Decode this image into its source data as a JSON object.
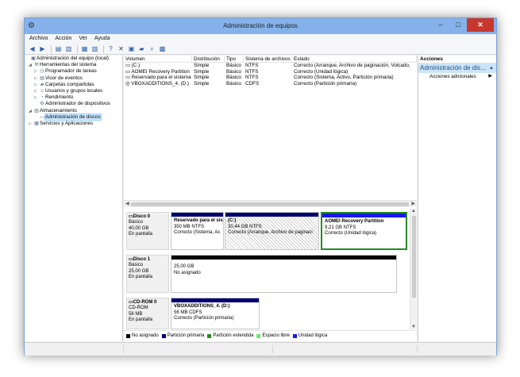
{
  "window": {
    "title": "Administración de equipos",
    "minimize": "–",
    "maximize": "□",
    "close": "✕"
  },
  "menu": [
    "Archivo",
    "Acción",
    "Ver",
    "Ayuda"
  ],
  "tree": [
    {
      "label": "Administración del equipo (local)",
      "level": 0,
      "arrow": "",
      "icon": "▣"
    },
    {
      "label": "Herramientas del sistema",
      "level": 1,
      "arrow": "◢",
      "icon": "⚒"
    },
    {
      "label": "Programador de tareas",
      "level": 2,
      "arrow": "▷",
      "icon": "◷"
    },
    {
      "label": "Visor de eventos",
      "level": 2,
      "arrow": "▷",
      "icon": "▤"
    },
    {
      "label": "Carpetas compartidas",
      "level": 2,
      "arrow": "▷",
      "icon": "▰"
    },
    {
      "label": "Usuarios y grupos locales",
      "level": 2,
      "arrow": "▷",
      "icon": "☺"
    },
    {
      "label": "Rendimiento",
      "level": 2,
      "arrow": "▷",
      "icon": "◔"
    },
    {
      "label": "Administrador de dispositivos",
      "level": 2,
      "arrow": "",
      "icon": "⚙"
    },
    {
      "label": "Almacenamiento",
      "level": 1,
      "arrow": "◢",
      "icon": "▥"
    },
    {
      "label": "Administración de discos",
      "level": 2,
      "arrow": "",
      "icon": "▭",
      "selected": true
    },
    {
      "label": "Servicios y Aplicaciones",
      "level": 1,
      "arrow": "▷",
      "icon": "▦"
    }
  ],
  "volume_table": {
    "headers": [
      "Volumen",
      "Distribución",
      "Tipo",
      "Sistema de archivos",
      "Estado"
    ],
    "rows": [
      [
        "(C:)",
        "Simple",
        "Básico",
        "NTFS",
        "Correcto (Arranque, Archivo de paginación, Volcado,"
      ],
      [
        "AOMEI Recovery Partition",
        "Simple",
        "Básico",
        "NTFS",
        "Correcto (Unidad lógica)"
      ],
      [
        "Reservado para el sistema",
        "Simple",
        "Básico",
        "NTFS",
        "Correcto (Sistema, Activo, Partición primaria)"
      ],
      [
        "VBOXADDITIONS_4. (D:)",
        "Simple",
        "Básico",
        "CDFS",
        "Correcto (Partición primaria)"
      ]
    ]
  },
  "disks": [
    {
      "name": "Disco 0",
      "type": "Básico",
      "size": "40,00 GB",
      "state": "En pantalla",
      "partitions": [
        {
          "name": "Reservado para el sis",
          "size": "350 MB NTFS",
          "status": "Correcto (Sistema, Ac",
          "bar_color": "#00006f",
          "hatched": false,
          "selected": false
        },
        {
          "name": "(C:)",
          "size": "30,44 GB NTFS",
          "status": "Correcto (Arranque, Archivo de paginaci",
          "bar_color": "#00006f",
          "hatched": true,
          "selected": false
        },
        {
          "name": "AOMEI Recovery Partition",
          "size": "9,21 GB NTFS",
          "status": "Correcto (Unidad lógica)",
          "bar_color": "#1818e8",
          "hatched": false,
          "selected": true
        }
      ]
    },
    {
      "name": "Disco 1",
      "type": "Básico",
      "size": "25,00 GB",
      "state": "En pantalla",
      "partitions": [
        {
          "name": "",
          "size": "25,00 GB",
          "status": "No asignado",
          "bar_color": "#000000",
          "hatched": false,
          "selected": false
        }
      ]
    },
    {
      "name": "CD-ROM 0",
      "type": "CD-ROM",
      "size": "56 MB",
      "state": "En pantalla",
      "partitions": [
        {
          "name": "VBOXADDITIONS_4. (D:)",
          "size": "56 MB CDFS",
          "status": "Correcto (Partición primaria)",
          "bar_color": "#00006f",
          "hatched": false,
          "selected": false
        }
      ]
    }
  ],
  "legend": [
    {
      "label": "No asignado",
      "color": "#000000"
    },
    {
      "label": "Partición primaria",
      "color": "#00006f"
    },
    {
      "label": "Partición extendida",
      "color": "#238b23"
    },
    {
      "label": "Espacio libre",
      "color": "#66ee66"
    },
    {
      "label": "Unidad lógica",
      "color": "#1818e8"
    }
  ],
  "actions": {
    "header": "Acciones",
    "section": "Administración de dis...",
    "items": [
      "Acciones adicionales"
    ]
  },
  "colors": {
    "titlebar": "#85b2ea",
    "close_button": "#c7372d",
    "selected_partition_border": "#238b23",
    "selection_highlight": "#cce4f7"
  }
}
